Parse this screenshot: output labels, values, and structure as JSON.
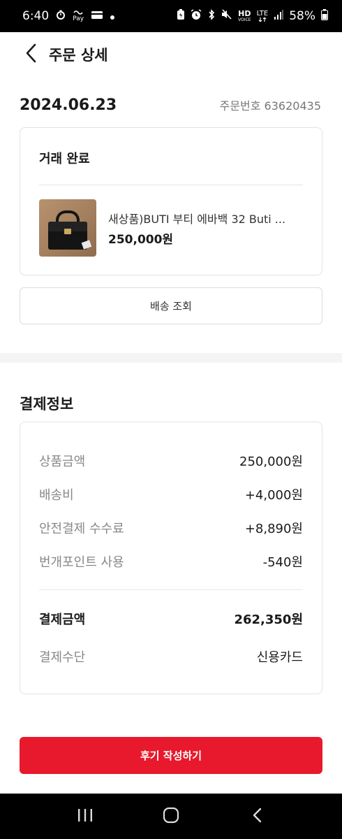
{
  "status_bar": {
    "time": "6:40",
    "battery": "58%",
    "pay_label": "Pay",
    "hd_label": "HD",
    "voice_label": "VOICE",
    "lte_label": "LTE"
  },
  "header": {
    "title": "주문 상세"
  },
  "order": {
    "date": "2024.06.23",
    "number_label": "주문번호 63620435"
  },
  "product_card": {
    "status": "거래 완료",
    "product_name": "새상품)BUTI 부티 에바백 32 Buti ...",
    "product_price": "250,000원"
  },
  "delivery_button": {
    "label": "배송 조회"
  },
  "payment": {
    "title": "결제정보",
    "rows": [
      {
        "label": "상품금액",
        "value": "250,000원"
      },
      {
        "label": "배송비",
        "value": "+4,000원"
      },
      {
        "label": "안전결제 수수료",
        "value": "+8,890원"
      },
      {
        "label": "번개포인트 사용",
        "value": "-540원"
      }
    ],
    "total": {
      "label": "결제금액",
      "value": "262,350원"
    },
    "method": {
      "label": "결제수단",
      "value": "신용카드"
    }
  },
  "review_button": {
    "label": "후기 작성하기"
  },
  "colors": {
    "accent": "#e8192c",
    "text_primary": "#1a1a1a",
    "text_secondary": "#888888",
    "border": "#e2e2e2"
  },
  "icons": {
    "back": "chevron-left-icon",
    "nav_recent": "recent-apps-icon",
    "nav_home": "home-icon",
    "nav_back": "nav-back-icon"
  }
}
